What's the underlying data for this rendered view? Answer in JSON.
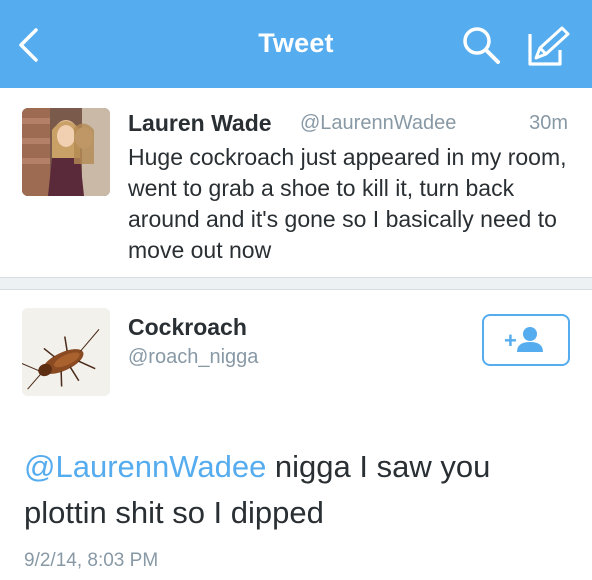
{
  "navbar": {
    "title": "Tweet",
    "back_icon": "chevron-left-icon",
    "search_icon": "search-icon",
    "compose_icon": "compose-icon",
    "background": "#55acee"
  },
  "tweet1": {
    "name": "Lauren Wade",
    "handle": "@LaurennWadee",
    "time": "30m",
    "text": "Huge cockroach just appeared in my room, went to grab a shoe to kill it, turn back around and it's gone so I basically need to move out now"
  },
  "tweet2": {
    "name": "Cockroach",
    "handle": "@roach_nigga",
    "follow_icon": "follow-user-icon",
    "mention": "@LaurennWadee",
    "text": " nigga I saw you plottin shit so I dipped",
    "date": "9/2/14, 8:03 PM"
  },
  "colors": {
    "accent": "#55acee",
    "secondary_text": "#8899a6",
    "primary_text": "#292f33"
  }
}
